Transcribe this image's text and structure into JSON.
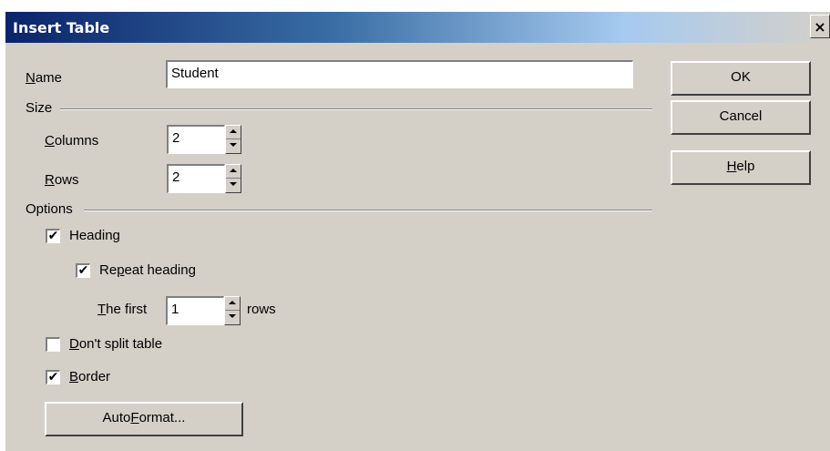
{
  "window": {
    "title": "Insert Table",
    "close_glyph": "×"
  },
  "name": {
    "label_u": "N",
    "label_rest": "ame",
    "value": "Student"
  },
  "size": {
    "section_label": "Size",
    "columns": {
      "label_u": "C",
      "label_rest": "olumns",
      "value": "2"
    },
    "rows": {
      "label_u": "R",
      "label_rest": "ows",
      "value": "2"
    }
  },
  "options": {
    "section_label": "Options",
    "heading": {
      "label_pre": "Headin",
      "label_u": "g",
      "label_post": "",
      "checked": true
    },
    "repeat_heading": {
      "label_pre": "Re",
      "label_u": "p",
      "label_post": "eat heading",
      "checked": true
    },
    "the_first": {
      "label_u": "T",
      "label_rest": "he first",
      "value": "1",
      "suffix": "rows"
    },
    "dont_split": {
      "label_u": "D",
      "label_rest": "on't split table",
      "checked": false
    },
    "border": {
      "label_u": "B",
      "label_rest": "order",
      "checked": true
    },
    "autoformat": {
      "label_pre": "Auto",
      "label_u": "F",
      "label_post": "ormat..."
    }
  },
  "buttons": {
    "ok": "OK",
    "cancel": "Cancel",
    "help_u": "H",
    "help_rest": "elp"
  },
  "check_glyph": "✔"
}
